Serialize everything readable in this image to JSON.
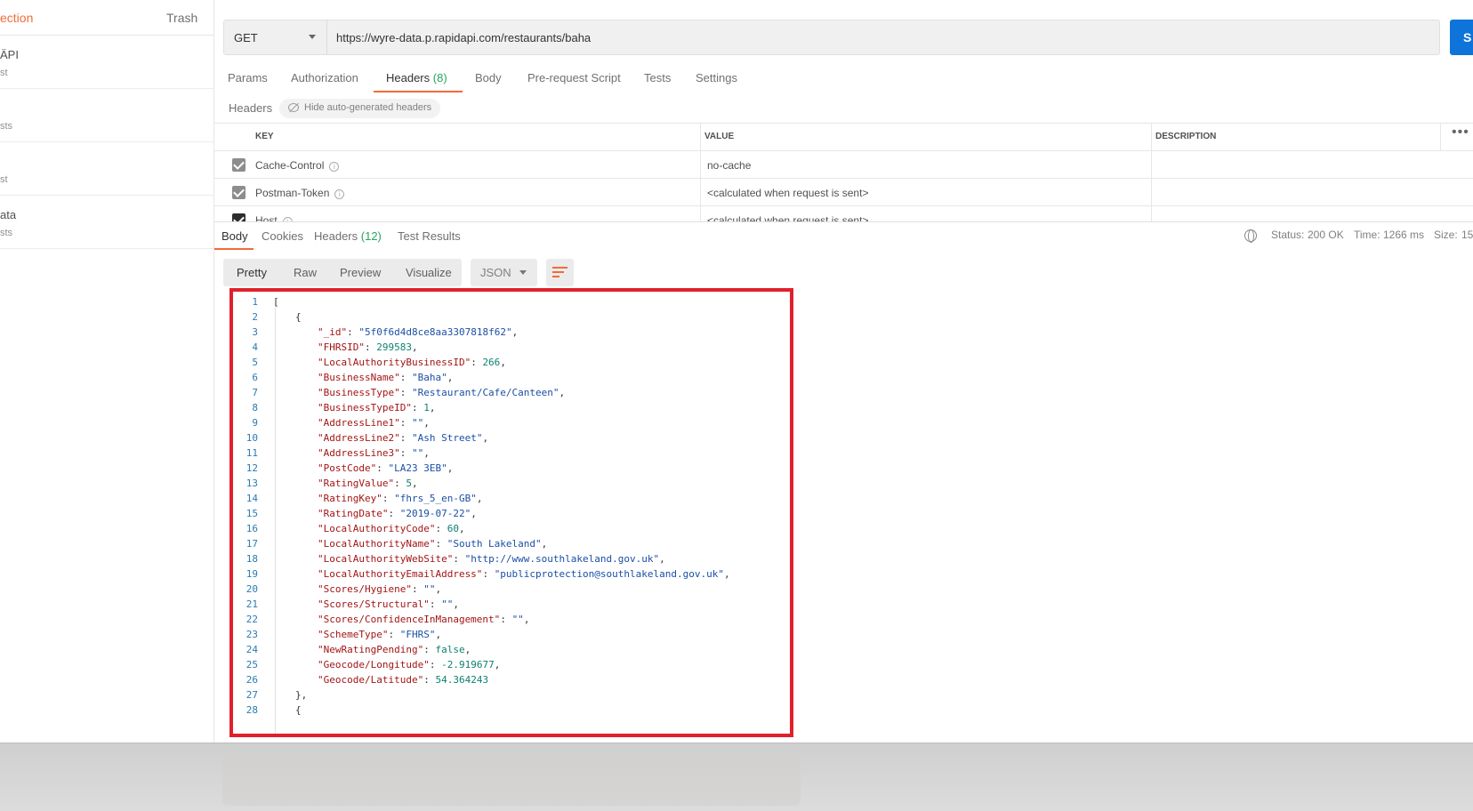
{
  "sidebar": {
    "tab_collections": "ection",
    "tab_trash": "Trash",
    "items": [
      {
        "name": "ÄPI",
        "meta": "st"
      },
      {
        "name": "",
        "meta": "sts"
      },
      {
        "name": "",
        "meta": "st"
      },
      {
        "name": "ata",
        "meta": "sts"
      }
    ]
  },
  "request": {
    "method": "GET",
    "url": "https://wyre-data.p.rapidapi.com/restaurants/baha",
    "send_label": "S"
  },
  "request_tabs": {
    "params": "Params",
    "authorization": "Authorization",
    "headers": "Headers",
    "headers_count": "(8)",
    "body": "Body",
    "prerequest": "Pre-request Script",
    "tests": "Tests",
    "settings": "Settings"
  },
  "headers_section": {
    "title": "Headers",
    "hide_auto": "Hide auto-generated headers",
    "columns": [
      "KEY",
      "VALUE",
      "DESCRIPTION"
    ],
    "rows": [
      {
        "key": "Cache-Control",
        "value": "no-cache"
      },
      {
        "key": "Postman-Token",
        "value": "<calculated when request is sent>"
      },
      {
        "key": "Host",
        "value": "<calculated when request is sent>"
      }
    ]
  },
  "response_tabs": {
    "body": "Body",
    "cookies": "Cookies",
    "headers": "Headers",
    "headers_count": "(12)",
    "test_results": "Test Results"
  },
  "status": {
    "status_label": "Status:",
    "status_value": "200 OK",
    "time_label": "Time:",
    "time_value": "1266 ms",
    "size_label": "Size:",
    "size_value": "15"
  },
  "view_options": {
    "pretty": "Pretty",
    "raw": "Raw",
    "preview": "Preview",
    "visualize": "Visualize",
    "format": "JSON"
  },
  "code_lines": [
    {
      "n": "1",
      "indent": 0,
      "key": "",
      "val": "",
      "type": "open-array"
    },
    {
      "n": "2",
      "indent": 1,
      "key": "",
      "val": "",
      "type": "open-obj"
    },
    {
      "n": "3",
      "indent": 2,
      "key": "\"_id\"",
      "val": "\"5f0f6d4d8ce8aa3307818f62\"",
      "type": "s"
    },
    {
      "n": "4",
      "indent": 2,
      "key": "\"FHRSID\"",
      "val": "299583",
      "type": "nm"
    },
    {
      "n": "5",
      "indent": 2,
      "key": "\"LocalAuthorityBusinessID\"",
      "val": "266",
      "type": "nm"
    },
    {
      "n": "6",
      "indent": 2,
      "key": "\"BusinessName\"",
      "val": "\"Baha\"",
      "type": "s"
    },
    {
      "n": "7",
      "indent": 2,
      "key": "\"BusinessType\"",
      "val": "\"Restaurant/Cafe/Canteen\"",
      "type": "s"
    },
    {
      "n": "8",
      "indent": 2,
      "key": "\"BusinessTypeID\"",
      "val": "1",
      "type": "nm"
    },
    {
      "n": "9",
      "indent": 2,
      "key": "\"AddressLine1\"",
      "val": "\"\"",
      "type": "s"
    },
    {
      "n": "10",
      "indent": 2,
      "key": "\"AddressLine2\"",
      "val": "\"Ash Street\"",
      "type": "s"
    },
    {
      "n": "11",
      "indent": 2,
      "key": "\"AddressLine3\"",
      "val": "\"\"",
      "type": "s"
    },
    {
      "n": "12",
      "indent": 2,
      "key": "\"PostCode\"",
      "val": "\"LA23 3EB\"",
      "type": "s"
    },
    {
      "n": "13",
      "indent": 2,
      "key": "\"RatingValue\"",
      "val": "5",
      "type": "nm"
    },
    {
      "n": "14",
      "indent": 2,
      "key": "\"RatingKey\"",
      "val": "\"fhrs_5_en-GB\"",
      "type": "s"
    },
    {
      "n": "15",
      "indent": 2,
      "key": "\"RatingDate\"",
      "val": "\"2019-07-22\"",
      "type": "s"
    },
    {
      "n": "16",
      "indent": 2,
      "key": "\"LocalAuthorityCode\"",
      "val": "60",
      "type": "nm"
    },
    {
      "n": "17",
      "indent": 2,
      "key": "\"LocalAuthorityName\"",
      "val": "\"South Lakeland\"",
      "type": "s"
    },
    {
      "n": "18",
      "indent": 2,
      "key": "\"LocalAuthorityWebSite\"",
      "val": "\"http://www.southlakeland.gov.uk\"",
      "type": "s"
    },
    {
      "n": "19",
      "indent": 2,
      "key": "\"LocalAuthorityEmailAddress\"",
      "val": "\"publicprotection@southlakeland.gov.uk\"",
      "type": "s"
    },
    {
      "n": "20",
      "indent": 2,
      "key": "\"Scores/Hygiene\"",
      "val": "\"\"",
      "type": "s"
    },
    {
      "n": "21",
      "indent": 2,
      "key": "\"Scores/Structural\"",
      "val": "\"\"",
      "type": "s"
    },
    {
      "n": "22",
      "indent": 2,
      "key": "\"Scores/ConfidenceInManagement\"",
      "val": "\"\"",
      "type": "s"
    },
    {
      "n": "23",
      "indent": 2,
      "key": "\"SchemeType\"",
      "val": "\"FHRS\"",
      "type": "s"
    },
    {
      "n": "24",
      "indent": 2,
      "key": "\"NewRatingPending\"",
      "val": "false",
      "type": "nm"
    },
    {
      "n": "25",
      "indent": 2,
      "key": "\"Geocode/Longitude\"",
      "val": "-2.919677",
      "type": "nm"
    },
    {
      "n": "26",
      "indent": 2,
      "key": "\"Geocode/Latitude\"",
      "val": "54.364243",
      "type": "nm-last"
    },
    {
      "n": "27",
      "indent": 1,
      "key": "",
      "val": "",
      "type": "close-obj"
    },
    {
      "n": "28",
      "indent": 1,
      "key": "",
      "val": "",
      "type": "open-obj"
    }
  ],
  "colors": {
    "accent": "#f26b3a",
    "send": "#0f74d9",
    "status_ok": "#26a65b",
    "highlight_box": "#e0202a"
  }
}
